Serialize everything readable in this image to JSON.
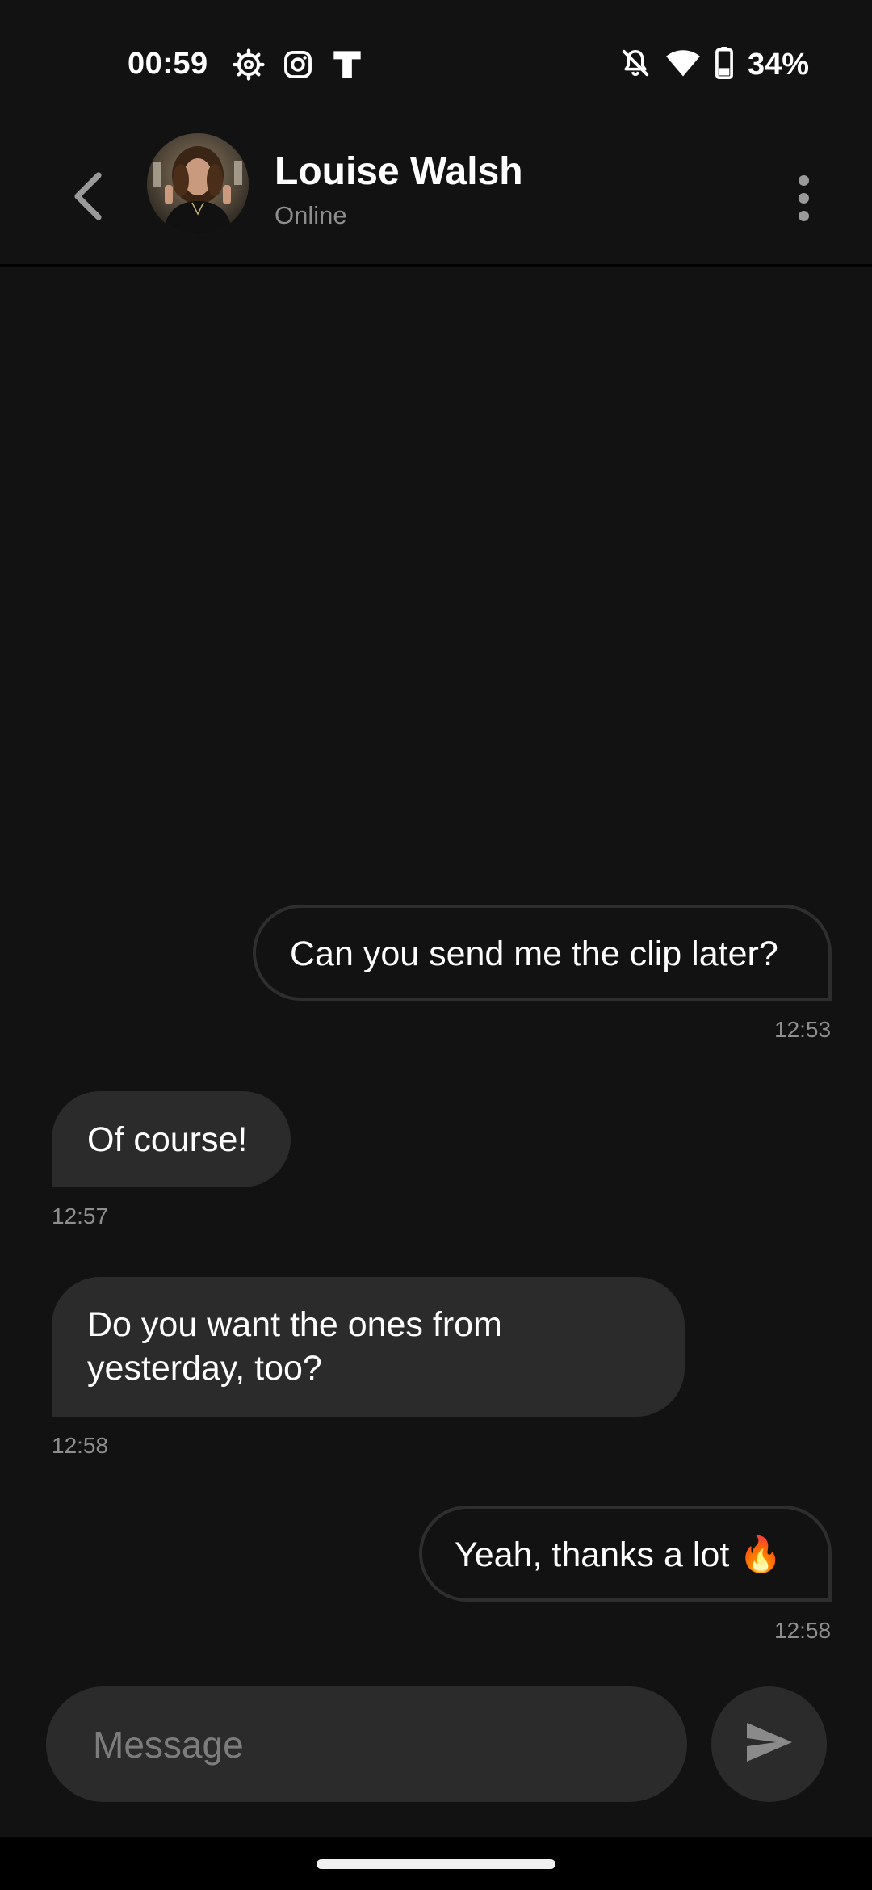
{
  "status_bar": {
    "time": "00:59",
    "battery": "34%",
    "left_icons": [
      "settings-gear-icon",
      "instagram-icon",
      "t-app-icon"
    ],
    "right_icons": [
      "notifications-off-icon",
      "wifi-icon",
      "battery-icon"
    ]
  },
  "header": {
    "contact_name": "Louise Walsh",
    "contact_status": "Online"
  },
  "messages": [
    {
      "direction": "outgoing",
      "text": "Can you send me the clip later?",
      "time": "12:53"
    },
    {
      "direction": "incoming",
      "text": "Of course!",
      "time": "12:57"
    },
    {
      "direction": "incoming",
      "text_line1": "Do you want the ones from",
      "text_line2": "yesterday, too?",
      "time": "12:58"
    },
    {
      "direction": "outgoing",
      "text": "Yeah, thanks a lot 🔥",
      "time": "12:58"
    }
  ],
  "composer": {
    "placeholder": "Message",
    "value": ""
  },
  "colors": {
    "background": "#121212",
    "bubble_incoming": "#2b2b2b",
    "bubble_outgoing_border": "#2e2e2e",
    "secondary_text": "#8e8e8e"
  }
}
